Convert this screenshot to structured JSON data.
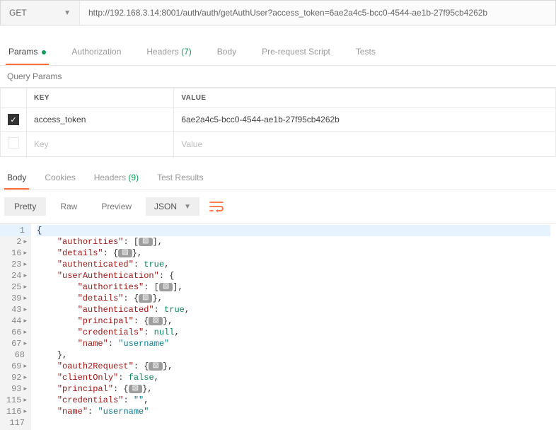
{
  "request": {
    "method": "GET",
    "url": "http://192.168.3.14:8001/auth/auth/getAuthUser?access_token=6ae2a4c5-bcc0-4544-ae1b-27f95cb4262b"
  },
  "reqTabs": {
    "params": "Params",
    "authorization": "Authorization",
    "headers": "Headers",
    "headers_count": "(7)",
    "body": "Body",
    "prerequest": "Pre-request Script",
    "tests": "Tests"
  },
  "sectionHeader": "Query Params",
  "paramsTable": {
    "keyH": "KEY",
    "valueH": "VALUE",
    "rows": [
      {
        "checked": true,
        "key": "access_token",
        "value": "6ae2a4c5-bcc0-4544-ae1b-27f95cb4262b"
      }
    ],
    "placeholder": {
      "key": "Key",
      "value": "Value"
    }
  },
  "respTabs": {
    "body": "Body",
    "cookies": "Cookies",
    "headers": "Headers",
    "headers_count": "(9)",
    "testresults": "Test Results"
  },
  "viewer": {
    "pretty": "Pretty",
    "raw": "Raw",
    "preview": "Preview",
    "fmt": "JSON"
  },
  "codeLines": [
    {
      "n": 1,
      "indent": 0,
      "hl": true,
      "raw": "{"
    },
    {
      "n": 2,
      "indent": 1,
      "key": "authorities",
      "fold": "[]",
      "trail": ","
    },
    {
      "n": 16,
      "indent": 1,
      "key": "details",
      "fold": "{}",
      "trail": ","
    },
    {
      "n": 23,
      "indent": 1,
      "key": "authenticated",
      "valRaw": "true",
      "trail": ","
    },
    {
      "n": 24,
      "indent": 1,
      "key": "userAuthentication",
      "open": "{"
    },
    {
      "n": 25,
      "indent": 2,
      "key": "authorities",
      "fold": "[]",
      "trail": ","
    },
    {
      "n": 39,
      "indent": 2,
      "key": "details",
      "fold": "{}",
      "trail": ","
    },
    {
      "n": 43,
      "indent": 2,
      "key": "authenticated",
      "valRaw": "true",
      "trail": ","
    },
    {
      "n": 44,
      "indent": 2,
      "key": "principal",
      "fold": "{}",
      "trail": ","
    },
    {
      "n": 66,
      "indent": 2,
      "key": "credentials",
      "valRaw": "null",
      "trail": ","
    },
    {
      "n": 67,
      "indent": 2,
      "key": "name",
      "valStr": "username"
    },
    {
      "n": 68,
      "indent": 1,
      "raw": "},"
    },
    {
      "n": 69,
      "indent": 1,
      "key": "oauth2Request",
      "fold": "{}",
      "trail": ","
    },
    {
      "n": 92,
      "indent": 1,
      "key": "clientOnly",
      "valRaw": "false",
      "trail": ","
    },
    {
      "n": 93,
      "indent": 1,
      "key": "principal",
      "fold": "{}",
      "trail": ","
    },
    {
      "n": 115,
      "indent": 1,
      "key": "credentials",
      "valStr": "",
      "trail": ","
    },
    {
      "n": 116,
      "indent": 1,
      "key": "name",
      "valStr": "username"
    },
    {
      "n": 117,
      "indent": 0,
      "raw": ""
    }
  ],
  "foldPill": "▧"
}
